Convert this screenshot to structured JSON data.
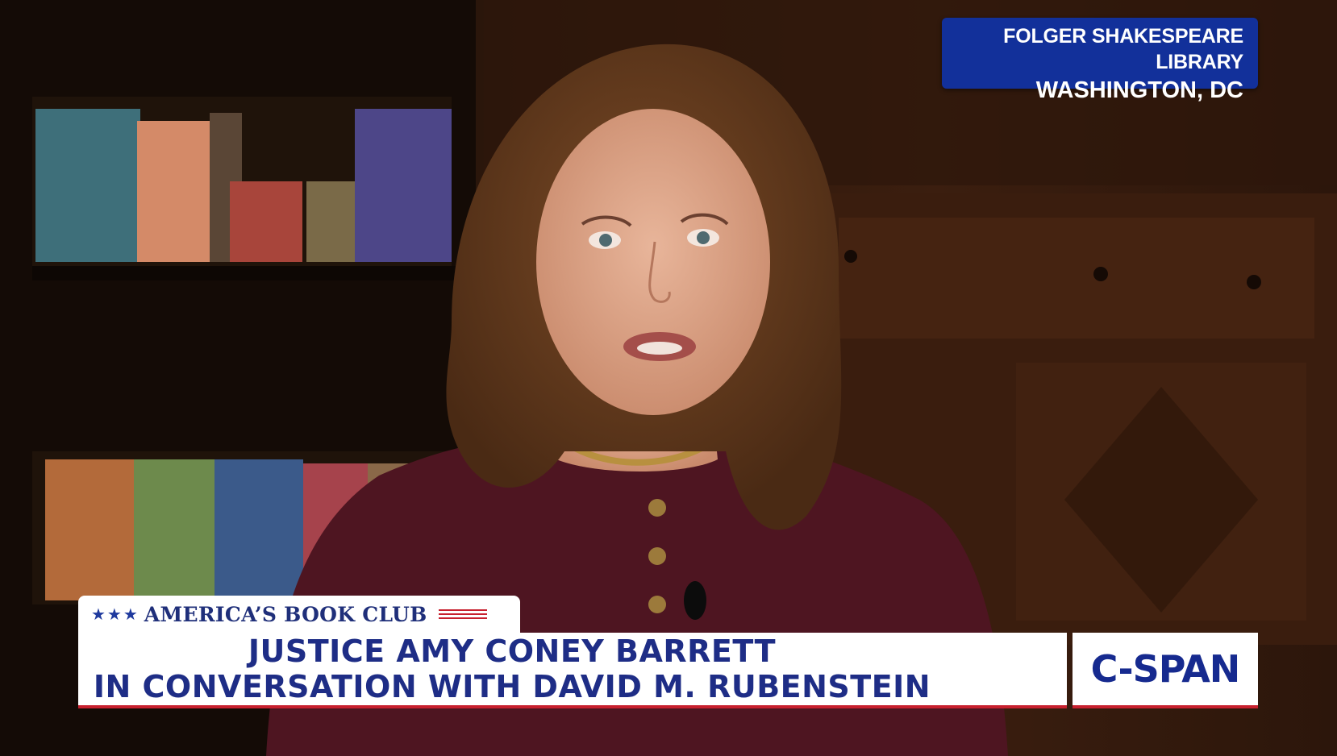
{
  "location": {
    "line1": "FOLGER SHAKESPEARE LIBRARY",
    "line2": "WASHINGTON, DC"
  },
  "show": {
    "stars": "★★★",
    "title": "AMERICA’S BOOK CLUB"
  },
  "lower_third": {
    "line1": "JUSTICE AMY CONEY BARRETT",
    "line2": "IN CONVERSATION WITH DAVID M. RUBENSTEIN"
  },
  "network": {
    "logo": "C-SPAN"
  },
  "colors": {
    "badge_blue": "#12309a",
    "title_navy": "#1e2d86",
    "accent_red": "#c7202e"
  }
}
